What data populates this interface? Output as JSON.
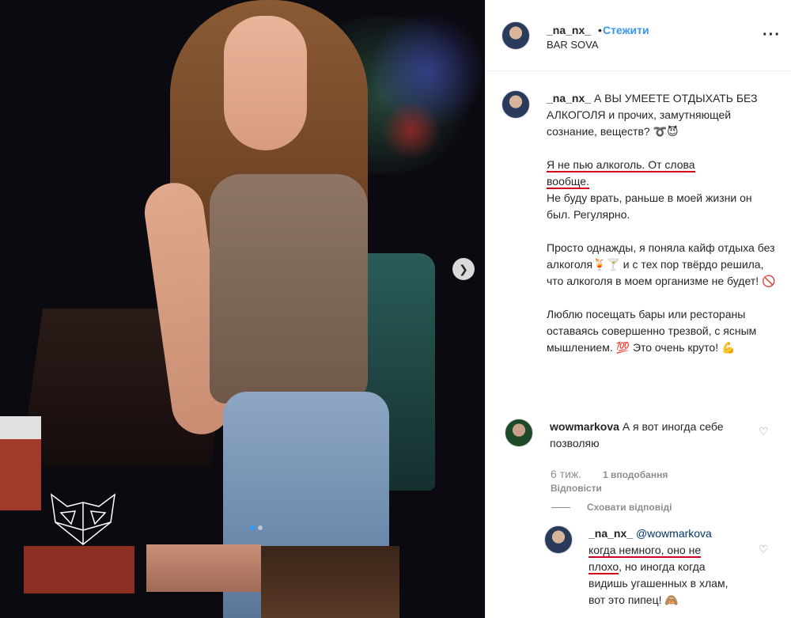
{
  "post": {
    "author": "_na_nx_",
    "follow_label": "Стежити",
    "location": "BAR SOVA",
    "more_icon": "more-horizontal-icon"
  },
  "caption": {
    "username": "_na_nx_",
    "p1": "А ВЫ УМЕЕТЕ ОТДЫХАТЬ БЕЗ АЛКОГОЛЯ и прочих, замутняющей сознание, веществ? ➰😈",
    "p2a": "Я не пью алкоголь. От слова",
    "p2b": "вообще.",
    "p2c": "Не буду врать, раньше в моей жизни он был. Регулярно.",
    "p3": "Просто однажды, я поняла кайф отдыха без алкоголя🍹🍸 и с тех пор твёрдо решила, что алкоголя в моем организме не будет! 🚫",
    "p4": "Люблю посещать бары или рестораны оставаясь совершенно трезвой, с ясным мышлением. 💯 Это очень круто! 💪"
  },
  "comments": [
    {
      "username": "wowmarkova",
      "text": "А я вот иногда себе позволяю",
      "time": "6 тиж.",
      "likes": "1 вподобання",
      "reply_label": "Відповісти",
      "hide_replies": "Сховати відповіді"
    }
  ],
  "reply": {
    "username": "_na_nx_",
    "mention": "@wowmarkova",
    "text_a": "когда немного, оно не",
    "text_b": "плохо",
    "text_c": ", но иногда когда видишь угашенных в хлам, вот это пипец! 🙈"
  },
  "photo": {
    "next_icon": "chevron-right-icon",
    "carousel_index": 1,
    "carousel_total": 2
  },
  "colors": {
    "link": "#3897f0",
    "underline": "#d0021b",
    "muted": "#8e8e8e"
  }
}
